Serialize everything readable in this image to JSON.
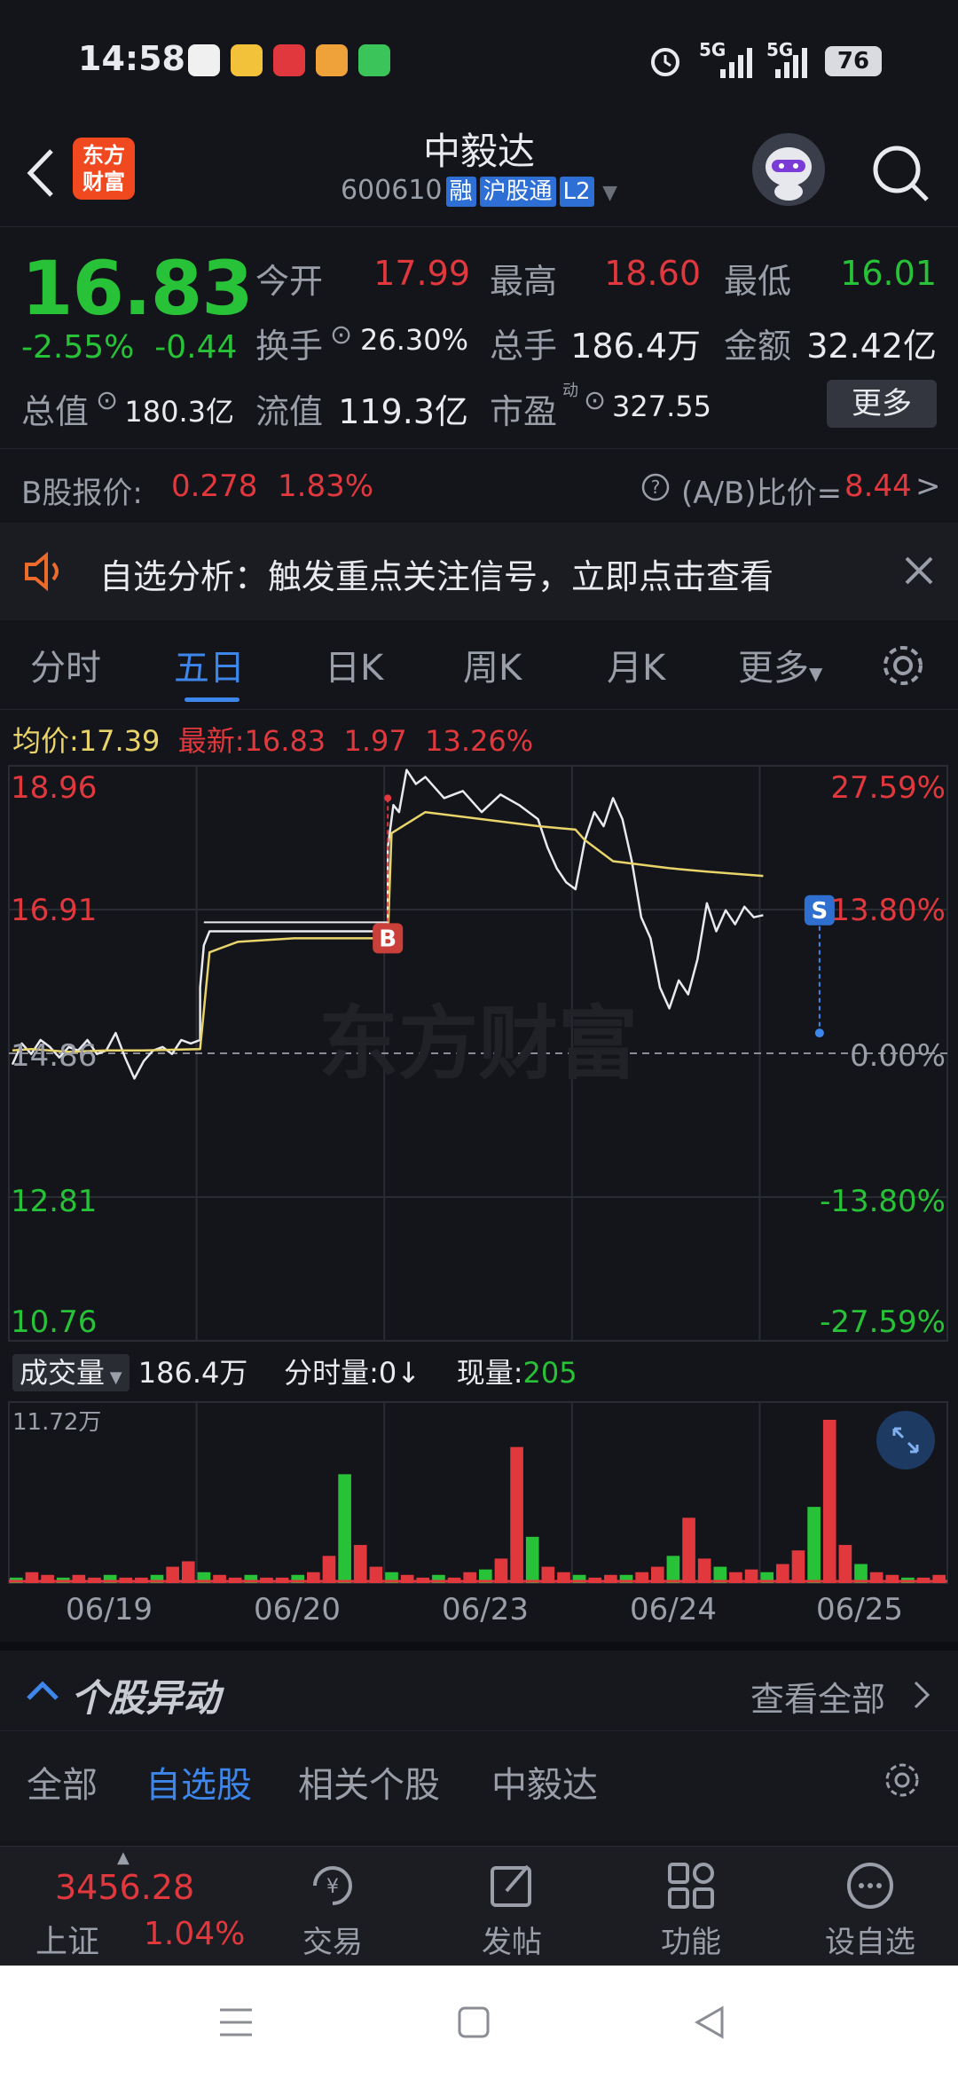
{
  "status_bar": {
    "time": "14:58",
    "network_1": "5G",
    "network_2": "5G",
    "battery": "76"
  },
  "header": {
    "logo_line1": "东方",
    "logo_line2": "财富",
    "title": "中毅达",
    "code": "600610",
    "tag_margin": "融",
    "tag_connect": "沪股通",
    "tag_level": "L2"
  },
  "quote": {
    "last_price": "16.83",
    "change_pct": "-2.55%",
    "change_abs": "-0.44",
    "open_label": "今开",
    "open_value": "17.99",
    "high_label": "最高",
    "high_value": "18.60",
    "low_label": "最低",
    "low_value": "16.01",
    "turnover_label": "换手",
    "turnover_value": "26.30%",
    "volume_label": "总手",
    "volume_value": "186.4万",
    "amount_label": "金额",
    "amount_value": "32.42亿",
    "mktcap_label": "总值",
    "mktcap_value": "180.3亿",
    "float_label": "流值",
    "float_value": "119.3亿",
    "pe_label": "市盈",
    "pe_sup": "动",
    "pe_value": "327.55",
    "more_label": "更多"
  },
  "b_share": {
    "label": "B股报价:",
    "price": "0.278",
    "pct": "1.83%",
    "ratio_label": "(A/B)比价=",
    "ratio_value": "8.44",
    "arrow": ">"
  },
  "notice": {
    "text": "自选分析：触发重点关注信号，立即点击查看"
  },
  "tabs": [
    "分时",
    "五日",
    "日K",
    "周K",
    "月K",
    "更多"
  ],
  "active_tab": 1,
  "chart_info": {
    "avg_label": "均价:",
    "avg_value": "17.39",
    "latest_label": "最新:",
    "latest_value": "16.83",
    "latest_chg": "1.97",
    "latest_pct": "13.26%"
  },
  "chart_data": {
    "type": "line",
    "title": "",
    "x_days": [
      "06/19",
      "06/20",
      "06/23",
      "06/24",
      "06/25"
    ],
    "y_axis_left": [
      "18.96",
      "16.91",
      "14.86",
      "12.81",
      "10.76"
    ],
    "y_axis_right": [
      "27.59%",
      "13.80%",
      "0.00%",
      "-13.80%",
      "-27.59%"
    ],
    "ylim": [
      10.76,
      18.96
    ],
    "prev_close": 14.86,
    "markers": [
      {
        "label": "B",
        "day": "06/23",
        "price": 16.5
      },
      {
        "label": "S",
        "day": "06/25",
        "price": 16.9
      }
    ],
    "series": [
      {
        "name": "均价",
        "color": "#e8d46a",
        "values": [
          [
            0,
            14.9
          ],
          [
            0.1,
            14.92
          ],
          [
            0.3,
            14.88
          ],
          [
            0.5,
            14.9
          ],
          [
            0.7,
            14.9
          ],
          [
            1.0,
            14.92
          ],
          [
            1.05,
            16.3
          ],
          [
            1.2,
            16.45
          ],
          [
            1.5,
            16.5
          ],
          [
            2.0,
            16.5
          ],
          [
            2.02,
            18.0
          ],
          [
            2.2,
            18.3
          ],
          [
            2.5,
            18.2
          ],
          [
            2.8,
            18.1
          ],
          [
            3.0,
            18.05
          ],
          [
            3.05,
            17.9
          ],
          [
            3.2,
            17.6
          ],
          [
            3.5,
            17.5
          ],
          [
            3.7,
            17.45
          ],
          [
            4.0,
            17.39
          ]
        ]
      },
      {
        "name": "价格",
        "color": "#e8eaee",
        "values": [
          [
            0,
            14.7
          ],
          [
            0.05,
            15.0
          ],
          [
            0.1,
            14.85
          ],
          [
            0.15,
            15.05
          ],
          [
            0.2,
            14.95
          ],
          [
            0.25,
            14.8
          ],
          [
            0.3,
            14.95
          ],
          [
            0.35,
            14.9
          ],
          [
            0.4,
            15.05
          ],
          [
            0.45,
            14.85
          ],
          [
            0.5,
            14.9
          ],
          [
            0.55,
            15.15
          ],
          [
            0.6,
            14.8
          ],
          [
            0.65,
            14.5
          ],
          [
            0.7,
            14.75
          ],
          [
            0.75,
            14.9
          ],
          [
            0.8,
            14.95
          ],
          [
            0.85,
            14.85
          ],
          [
            0.9,
            15.05
          ],
          [
            0.95,
            15.0
          ],
          [
            1.0,
            15.05
          ],
          [
            1.0,
            15.8
          ],
          [
            1.02,
            16.4
          ],
          [
            1.05,
            16.6
          ],
          [
            1.1,
            16.6
          ],
          [
            1.3,
            16.6
          ],
          [
            1.6,
            16.6
          ],
          [
            1.8,
            16.6
          ],
          [
            2.0,
            16.6
          ],
          [
            2.0,
            17.8
          ],
          [
            2.03,
            18.4
          ],
          [
            2.06,
            18.3
          ],
          [
            2.1,
            18.9
          ],
          [
            2.15,
            18.7
          ],
          [
            2.2,
            18.8
          ],
          [
            2.3,
            18.5
          ],
          [
            2.4,
            18.6
          ],
          [
            2.5,
            18.3
          ],
          [
            2.6,
            18.55
          ],
          [
            2.7,
            18.4
          ],
          [
            2.8,
            18.2
          ],
          [
            2.85,
            17.8
          ],
          [
            2.9,
            17.5
          ],
          [
            2.95,
            17.3
          ],
          [
            3.0,
            17.2
          ],
          [
            3.05,
            17.9
          ],
          [
            3.1,
            18.3
          ],
          [
            3.15,
            18.1
          ],
          [
            3.2,
            18.5
          ],
          [
            3.25,
            18.2
          ],
          [
            3.3,
            17.6
          ],
          [
            3.35,
            16.8
          ],
          [
            3.4,
            16.5
          ],
          [
            3.45,
            15.8
          ],
          [
            3.5,
            15.5
          ],
          [
            3.55,
            15.9
          ],
          [
            3.6,
            15.7
          ],
          [
            3.65,
            16.2
          ],
          [
            3.7,
            17.0
          ],
          [
            3.75,
            16.6
          ],
          [
            3.8,
            16.9
          ],
          [
            3.85,
            16.7
          ],
          [
            3.9,
            16.95
          ],
          [
            3.95,
            16.8
          ],
          [
            4.0,
            16.83
          ]
        ]
      }
    ]
  },
  "volume": {
    "label": "成交量",
    "total": "186.4万",
    "tick_label": "分时量:0",
    "arrow": "↓",
    "current_label": "现量:",
    "current_value": "205",
    "max": "11.72万",
    "values": [
      2,
      4,
      3,
      2,
      3,
      2,
      3,
      2,
      2,
      3,
      6,
      8,
      4,
      3,
      2,
      3,
      2,
      2,
      3,
      4,
      10,
      40,
      14,
      6,
      4,
      3,
      2,
      3,
      2,
      4,
      5,
      9,
      50,
      17,
      6,
      4,
      3,
      2,
      3,
      3,
      4,
      6,
      10,
      24,
      9,
      6,
      4,
      5,
      4,
      7,
      12,
      28,
      60,
      14,
      7,
      4,
      3,
      2,
      2,
      3
    ]
  },
  "movement": {
    "title": "个股异动",
    "view_all": "查看全部",
    "tabs": [
      "全部",
      "自选股",
      "相关个股",
      "中毅达"
    ],
    "active_tab": 1
  },
  "bottom_nav": {
    "index_value": "3456.28",
    "index_name": "上证",
    "index_pct": "1.04%",
    "items": [
      "交易",
      "发帖",
      "功能",
      "设自选"
    ]
  },
  "colors": {
    "up": "#e0383d",
    "down": "#27c237",
    "accent": "#3c86ec",
    "avg_line": "#e8d46a"
  }
}
